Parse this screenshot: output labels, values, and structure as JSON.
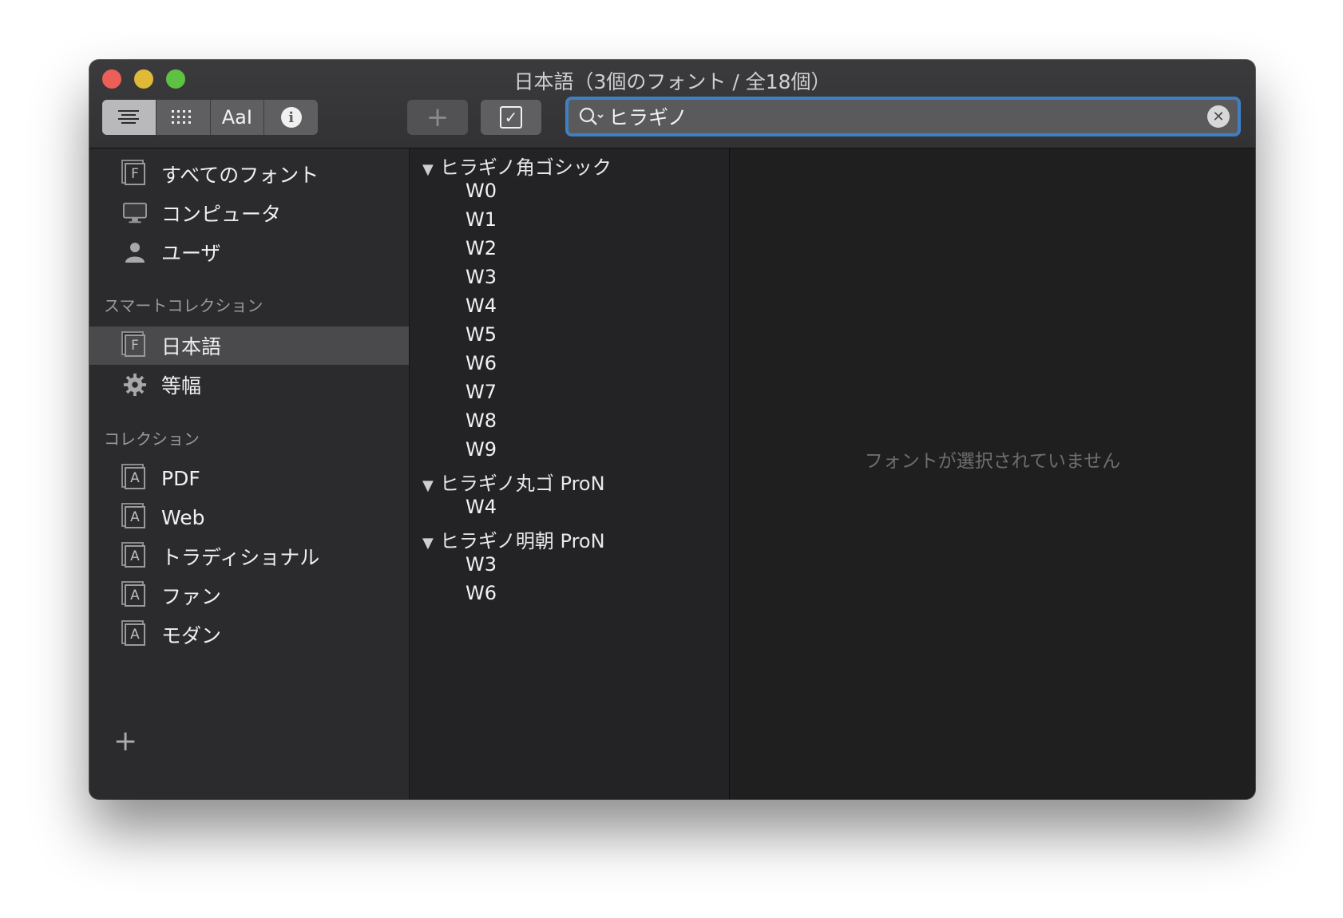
{
  "window": {
    "title": "日本語（3個のフォント / 全18個）"
  },
  "toolbar": {
    "view_modes": [
      {
        "name": "list-view",
        "label": ""
      },
      {
        "name": "grid-view",
        "label": ""
      },
      {
        "name": "sample-view",
        "label": "AaI"
      },
      {
        "name": "info-view",
        "label": "i"
      }
    ],
    "add_label": "+",
    "check_label": "✓"
  },
  "search": {
    "value": "ヒラギノ",
    "clear_label": "✕"
  },
  "sidebar": {
    "library_items": [
      {
        "label": "すべてのフォント",
        "icon": "font-box-icon",
        "icon_text": "F"
      },
      {
        "label": "コンピュータ",
        "icon": "computer-icon"
      },
      {
        "label": "ユーザ",
        "icon": "user-icon"
      }
    ],
    "smart_header": "スマートコレクション",
    "smart_items": [
      {
        "label": "日本語",
        "icon": "font-box-icon",
        "icon_text": "F",
        "selected": true
      },
      {
        "label": "等幅",
        "icon": "gear-icon"
      }
    ],
    "collection_header": "コレクション",
    "collection_items": [
      {
        "label": "PDF",
        "icon_text": "A"
      },
      {
        "label": "Web",
        "icon_text": "A"
      },
      {
        "label": "トラディショナル",
        "icon_text": "A"
      },
      {
        "label": "ファン",
        "icon_text": "A"
      },
      {
        "label": "モダン",
        "icon_text": "A"
      }
    ],
    "add_label": "+"
  },
  "font_list": {
    "families": [
      {
        "name": "ヒラギノ角ゴシック",
        "faces": [
          "W0",
          "W1",
          "W2",
          "W3",
          "W4",
          "W5",
          "W6",
          "W7",
          "W8",
          "W9"
        ]
      },
      {
        "name": "ヒラギノ丸ゴ ProN",
        "faces": [
          "W4"
        ]
      },
      {
        "name": "ヒラギノ明朝 ProN",
        "faces": [
          "W3",
          "W6"
        ]
      }
    ],
    "disclosure": "▼"
  },
  "preview": {
    "message": "フォントが選択されていません"
  },
  "colors": {
    "selection": "#4a4a4d",
    "search_focus": "#3f7fc2",
    "close": "#ec5f57",
    "minimize": "#e0b938",
    "maximize": "#5fc143"
  }
}
